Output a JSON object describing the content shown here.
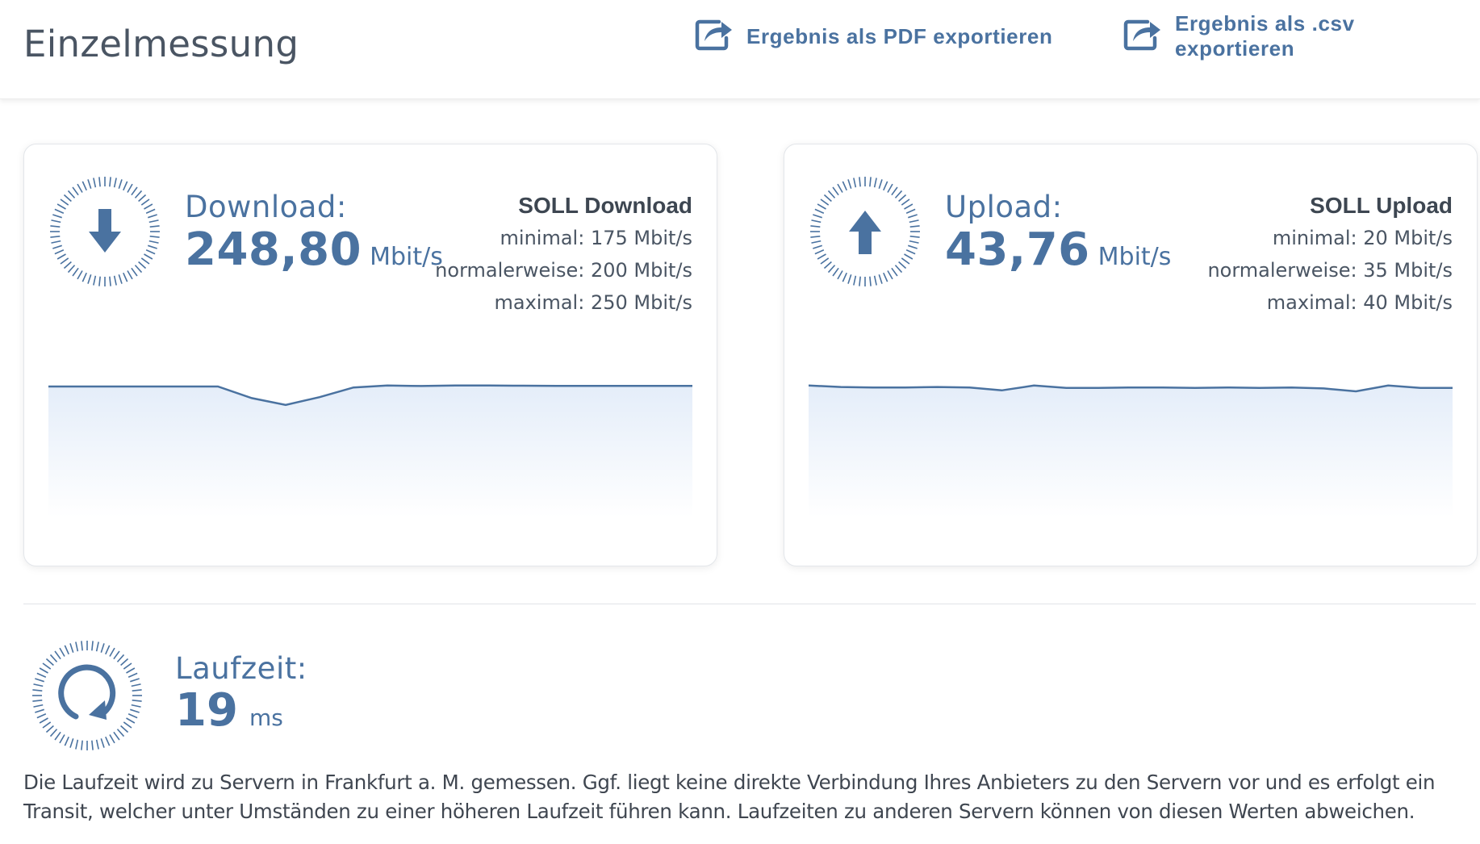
{
  "header": {
    "title": "Einzelmessung",
    "export_pdf_label": "Ergebnis als PDF exportieren",
    "export_csv_label": "Ergebnis als .csv exportieren"
  },
  "download": {
    "label": "Download:",
    "value": "248,80",
    "unit": "Mbit/s",
    "soll_title": "SOLL Download",
    "soll_min": "minimal: 175 Mbit/s",
    "soll_normal": "normalerweise: 200 Mbit/s",
    "soll_max": "maximal: 250 Mbit/s",
    "icon": "arrow-down-icon",
    "trend": [
      0.85,
      0.85,
      0.85,
      0.85,
      0.85,
      0.85,
      0.73,
      0.66,
      0.74,
      0.84,
      0.86,
      0.855,
      0.86,
      0.86,
      0.858,
      0.856,
      0.856,
      0.856,
      0.856,
      0.856
    ]
  },
  "upload": {
    "label": "Upload:",
    "value": "43,76",
    "unit": "Mbit/s",
    "soll_title": "SOLL Upload",
    "soll_min": "minimal: 20 Mbit/s",
    "soll_normal": "normalerweise: 35 Mbit/s",
    "soll_max": "maximal: 40 Mbit/s",
    "icon": "arrow-up-icon",
    "trend": [
      0.86,
      0.845,
      0.84,
      0.84,
      0.845,
      0.84,
      0.81,
      0.86,
      0.835,
      0.835,
      0.84,
      0.84,
      0.835,
      0.84,
      0.835,
      0.84,
      0.83,
      0.8,
      0.86,
      0.835,
      0.835
    ]
  },
  "latency": {
    "label": "Laufzeit:",
    "value": "19",
    "unit": "ms",
    "icon": "refresh-icon",
    "note": "Die Laufzeit wird zu Servern in Frankfurt a. M. gemessen. Ggf. liegt keine direkte Verbindung Ihres Anbieters zu den Servern vor und es erfolgt ein Transit, welcher unter Umständen zu einer höheren Laufzeit führen kann. Laufzeiten zu anderen Servern können von diesen Werten abweichen."
  },
  "colors": {
    "accent": "#4a72a0",
    "text": "#4a5563",
    "fill_top": "#e4edf9"
  }
}
